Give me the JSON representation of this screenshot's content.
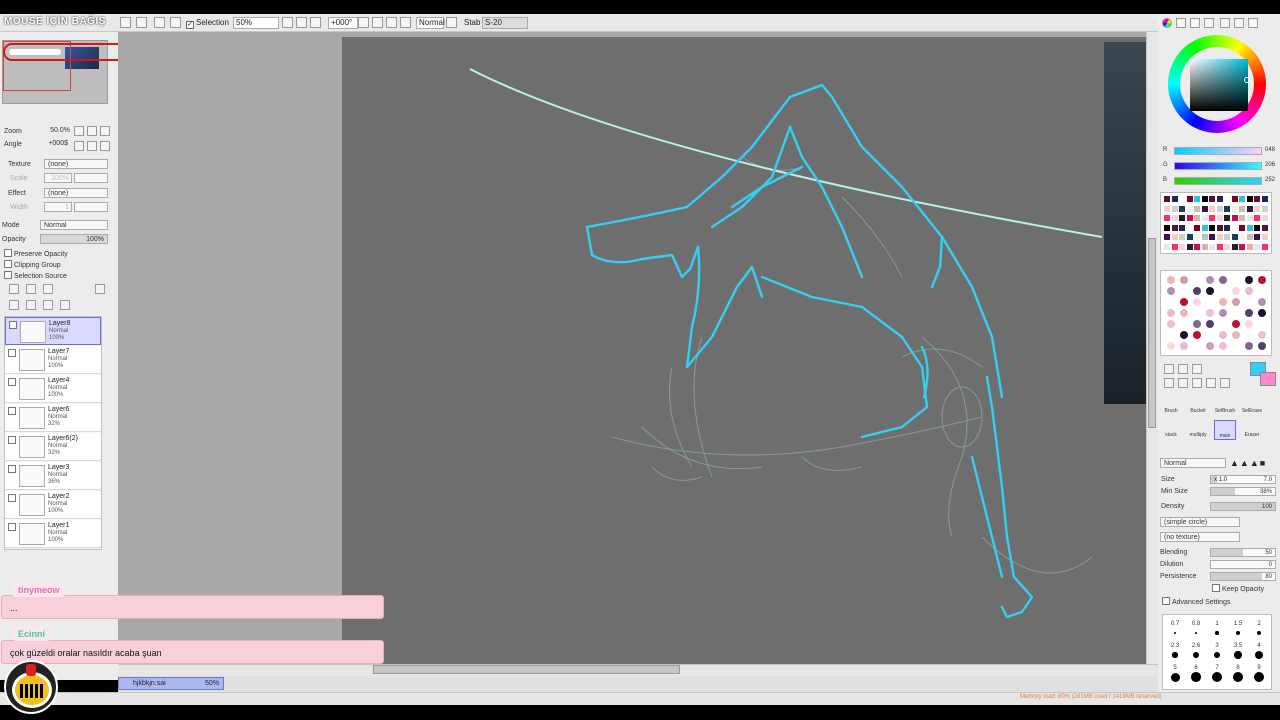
{
  "overlay_title": "MOUSE İÇİN BAĞIŞ",
  "toolbar": {
    "selection_label": "Selection",
    "zoom_value": "50%",
    "angle_value": "+000°",
    "blend_mode": "Normal",
    "stabilizer_label": "Stab",
    "stabilizer_value": "S-20"
  },
  "navigator": {
    "zoom_label": "Zoom",
    "zoom_value": "50.0%",
    "angle_label": "Angle",
    "angle_value": "+000$"
  },
  "texture": {
    "label": "Texture",
    "value": "(none)",
    "scale_label": "Scale",
    "scale_value": "100%"
  },
  "effect": {
    "label": "Effect",
    "value": "(none)",
    "width_label": "Width",
    "width_value": "1"
  },
  "layer_props": {
    "mode_label": "Mode",
    "mode_value": "Normal",
    "opacity_label": "Opacity",
    "opacity_value": "100%",
    "preserve_opacity": "Preserve Opacity",
    "clipping_group": "Clipping Group",
    "selection_source": "Selection Source"
  },
  "layers": [
    {
      "name": "Layer8",
      "mode": "Normal",
      "opacity": "100%",
      "selected": true
    },
    {
      "name": "Layer7",
      "mode": "Normal",
      "opacity": "100%"
    },
    {
      "name": "Layer4",
      "mode": "Normal",
      "opacity": "100%"
    },
    {
      "name": "Layer6",
      "mode": "Normal",
      "opacity": "32%"
    },
    {
      "name": "Layer6(2)",
      "mode": "Normal",
      "opacity": "32%"
    },
    {
      "name": "Layer3",
      "mode": "Normal",
      "opacity": "36%"
    },
    {
      "name": "Layer2",
      "mode": "Normal",
      "opacity": "100%"
    },
    {
      "name": "Layer1",
      "mode": "Normal",
      "opacity": "100%"
    }
  ],
  "file_tab": {
    "name": "hjkbkjn.sai",
    "zoom": "50%"
  },
  "status": {
    "memory": "Memory load: 80% (281MB used / 1419MB reserved)"
  },
  "color": {
    "r_label": "R",
    "r_value": "048",
    "g_label": "G",
    "g_value": "206",
    "b_label": "B",
    "b_value": "252",
    "current": "#30cefc",
    "secondary": "#ff88cc"
  },
  "tools": [
    "Brush",
    "Bucket",
    "SelBrush",
    "SelErase",
    "stack",
    "multiply",
    "main",
    "Eraser"
  ],
  "brush": {
    "blend_mode": "Normal",
    "size_label": "Size",
    "size_multiplier": "x 1.0",
    "size_value": "7.0",
    "min_size_label": "Min Size",
    "min_size_value": "38%",
    "density_label": "Density",
    "density_value": "100",
    "shape": "(simple circle)",
    "texture": "(no texture)",
    "blending_label": "Blending",
    "blending_value": "50",
    "dilution_label": "Dilution",
    "dilution_value": "0",
    "persistence_label": "Persistence",
    "persistence_value": "80",
    "keep_opacity": "Keep Opacity",
    "advanced": "Advanced Settings"
  },
  "brush_sizes": [
    "0.7",
    "0.8",
    "1",
    "1.5",
    "2",
    "2.3",
    "2.6",
    "3",
    "3.5",
    "4",
    "5",
    "6",
    "7",
    "8",
    "9"
  ],
  "chat": [
    {
      "user": "tinymeow",
      "user_color": "#e070b0",
      "message": "..."
    },
    {
      "user": "Ecinni",
      "user_color": "#40c8b0",
      "message": "çok güzeldi oralar nasıldır acaba şuan"
    }
  ]
}
